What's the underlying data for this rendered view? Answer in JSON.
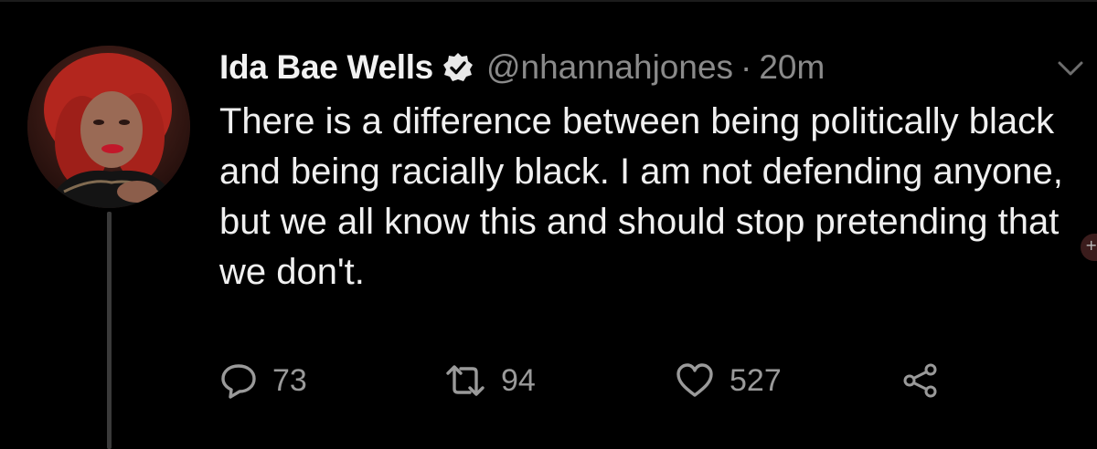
{
  "tweet": {
    "author": {
      "name": "Ida Bae Wells",
      "handle": "@nhannahjones",
      "verified": true,
      "avatar_icon": "profile-photo"
    },
    "separator": "·",
    "time": "20m",
    "text": "There is a difference between being politically black and being racially black. I am not defending anyone, but we all know this and should stop pretending that we don't.",
    "actions": {
      "reply": {
        "icon": "reply-bubble-icon",
        "count": "73"
      },
      "retweet": {
        "icon": "retweet-icon",
        "count": "94"
      },
      "like": {
        "icon": "heart-icon",
        "count": "527"
      },
      "share": {
        "icon": "share-icon"
      }
    }
  },
  "theme": {
    "background": "#000000",
    "text": "#f0f0f0",
    "muted": "#8a8a8a"
  },
  "side_tab": {
    "label": "+"
  }
}
